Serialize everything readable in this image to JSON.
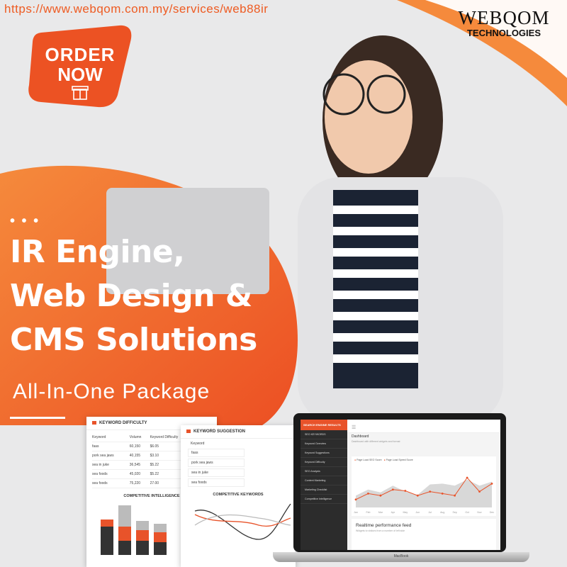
{
  "url": "https://www.webqom.com.my/services/web88ir",
  "logo": {
    "brand": "WEBQOM",
    "tagline": "TECHNOLOGIES"
  },
  "order_badge": {
    "line1": "ORDER",
    "line2": "NOW",
    "icon": "gift-icon"
  },
  "headline": {
    "dots": "• • •",
    "line1": "IR Engine,",
    "line2": "Web Design &",
    "line3": "CMS Solutions",
    "subtitle": "All-In-One Package"
  },
  "keyword_difficulty": {
    "title": "KEYWORD DIFFICULTY",
    "columns": [
      "Keyword",
      "Volumn",
      "Keyword Difficulty"
    ],
    "rows": [
      [
        "faas",
        "60,150",
        "$6.05"
      ],
      [
        "pork sea jaws",
        "40,155",
        "$3.10"
      ],
      [
        "sea in juke",
        "36,545",
        "$5.22"
      ],
      [
        "sea foods",
        "45,020",
        "$5.22"
      ],
      [
        "sea foods",
        "75,220",
        "27.00"
      ]
    ],
    "chart_title": "COMPETITIVE INTELLIGENCE"
  },
  "keyword_suggestion": {
    "title": "KEYWORD SUGGESTION",
    "label": "Keyword",
    "items": [
      "faas",
      "pork sea jaws",
      "sea in juke",
      "sea foods"
    ],
    "chart_title": "COMPETITIVE KEYWORDS"
  },
  "laptop": {
    "brand": "MacBook",
    "sidebar_header": "SEARCH ENGINE RESULTS",
    "sidebar_items": [
      "SEO KEYWORDS",
      "Keyword Overview",
      "Keyword Suggestions",
      "Keyword Difficulty",
      "SEO Analysis",
      "Content Marketing",
      "Marketing Checklist",
      "Competitive Intelligence"
    ],
    "dashboard_title": "Dashboard",
    "dashboard_sub": "Dashboard with different widgets and format",
    "legend": [
      "Page Load SEO Score",
      "Page Load Speed Score"
    ],
    "realtime_title": "Realtime performance feed",
    "realtime_sub": "Widgets to visitors from a number of left side"
  },
  "colors": {
    "accent": "#ee5b22",
    "accent2": "#f58a3c",
    "dark": "#2c2c2c"
  },
  "chart_data": [
    {
      "type": "area",
      "x": [
        "Jan",
        "Feb",
        "Mar",
        "Apr",
        "May",
        "Jun",
        "Jul",
        "Aug",
        "Sep",
        "Oct",
        "Nov",
        "Dec"
      ],
      "series": [
        {
          "name": "Page Load SEO Score",
          "values": [
            30,
            45,
            38,
            55,
            40,
            32,
            58,
            60,
            55,
            70,
            55,
            65
          ]
        },
        {
          "name": "Page Load Speed Score",
          "values": [
            20,
            35,
            30,
            45,
            42,
            30,
            40,
            35,
            30,
            75,
            40,
            60
          ]
        }
      ]
    }
  ]
}
